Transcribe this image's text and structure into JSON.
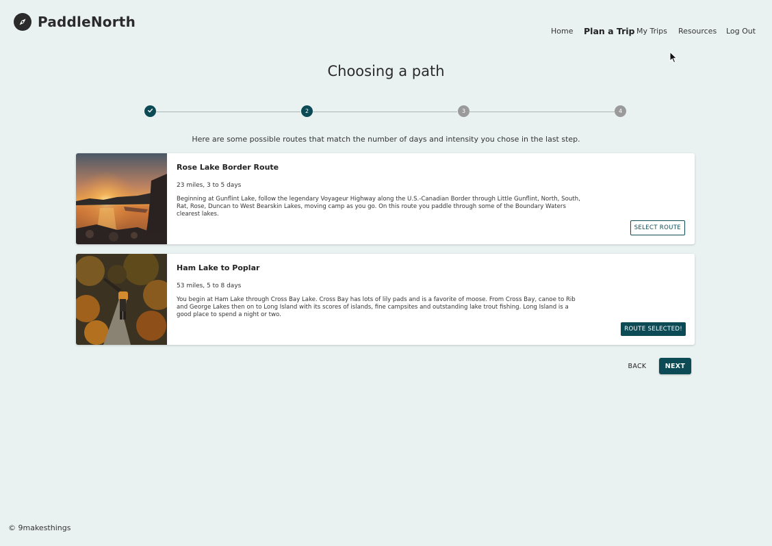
{
  "app": {
    "name": "PaddleNorth",
    "logo_icon": "compass-icon"
  },
  "nav": {
    "home": "Home",
    "plan": "Plan a Trip",
    "my_trips": "My Trips",
    "resources": "Resources",
    "logout": "Log Out"
  },
  "page": {
    "title": "Choosing a path",
    "intro": "Here are some possible routes that match the number of days and intensity you chose in the last step."
  },
  "stepper": {
    "current_step": 2,
    "steps": [
      {
        "label": "",
        "state": "done",
        "icon": "check-icon"
      },
      {
        "label": "2",
        "state": "current"
      },
      {
        "label": "3",
        "state": "future"
      },
      {
        "label": "4",
        "state": "future"
      }
    ]
  },
  "routes": [
    {
      "title": "Rose Lake Border Route",
      "meta": "23 miles, 3 to 5 days",
      "description": "Beginning at Gunflint Lake, follow the legendary Voyageur Highway along the U.S.-Canadian Border through Little Gunflint, North, South, Rat, Rose, Duncan to West Bearskin Lakes, moving camp as you go. On this route you paddle through some of the Boundary Waters clearest lakes.",
      "button": "SELECT ROUTE",
      "selected": false
    },
    {
      "title": "Ham Lake to Poplar",
      "meta": "53 miles, 5 to 8 days",
      "description": "You begin at Ham Lake through Cross Bay Lake. Cross Bay has lots of lily pads and is a favorite of moose. From Cross Bay, canoe to Rib and George Lakes then on to Long Island with its scores of islands, fine campsites and outstanding lake trout fishing. Long Island is a good place to spend a night or two.",
      "button": "ROUTE SELECTED!",
      "selected": true
    }
  ],
  "actions": {
    "back": "BACK",
    "next": "NEXT"
  },
  "footer": {
    "text": "© 9makesthings"
  },
  "colors": {
    "background": "#eaf2f1",
    "accent": "#0c4a55",
    "inactive_step": "#9a9a9a"
  }
}
